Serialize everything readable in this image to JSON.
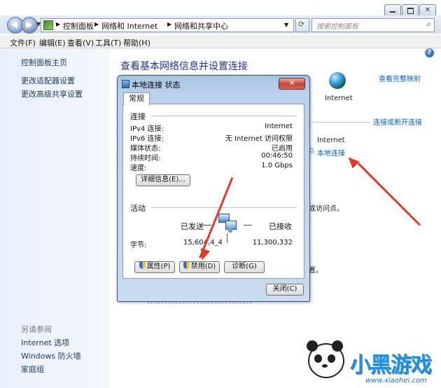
{
  "window": {
    "breadcrumb": [
      "控制面板",
      "网络和 Internet",
      "网络和共享中心"
    ],
    "search_placeholder": "搜索控制面板"
  },
  "menu": [
    "文件(F)",
    "编辑(E)",
    "查看(V)",
    "工具(T)",
    "帮助(H)"
  ],
  "sidebar": {
    "links": [
      "控制面板主页",
      "更改适配器设置",
      "更改高级共享设置"
    ],
    "see_also_label": "另请参阅",
    "see_also": [
      "Internet 选项",
      "Windows 防火墙",
      "家庭组"
    ]
  },
  "content": {
    "title": "查看基本网络信息并设置连接",
    "view_full_map": "查看完整映射",
    "internet_label": "Internet",
    "connect_disconnect": "连接或断开连接",
    "access_type_value": "Internet",
    "connection_link": "本地连接",
    "partial_text_1": "或访问点。",
    "partial_text_2": "置。"
  },
  "dialog": {
    "title": "本地连接 状态",
    "close_label": "✕",
    "tab_label": "常规",
    "connection_group": "连接",
    "rows": [
      {
        "label": "IPv4 连接:",
        "value": "Internet"
      },
      {
        "label": "IPv6 连接:",
        "value": "无 Internet 访问权限"
      },
      {
        "label": "媒体状态:",
        "value": "已启用"
      },
      {
        "label": "持续时间:",
        "value": "00:46:50"
      },
      {
        "label": "速度:",
        "value": "1.0 Gbps"
      }
    ],
    "details_button": "详细信息(E)...",
    "activity_group": "活动",
    "sent_label": "已发送",
    "received_label": "已接收",
    "bytes_label": "字节:",
    "bytes_sent": "15,604,4_4",
    "bytes_received": "11,300,332",
    "buttons": [
      "属性(P)",
      "禁用(D)",
      "诊断(G)"
    ],
    "close_button": "关闭(C)"
  },
  "watermark": {
    "text": "小黑游戏",
    "url": "www.xiaohei.com"
  },
  "colors": {
    "link": "#0b5db3",
    "title": "#1e3287",
    "annotation_arrow": "#e0392b"
  }
}
